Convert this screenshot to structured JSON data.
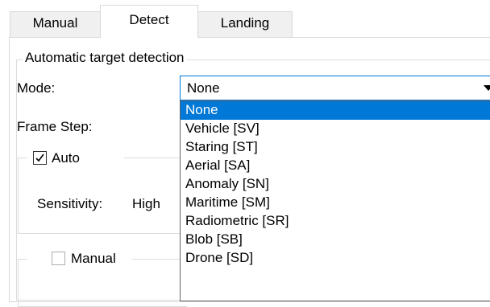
{
  "tabs": [
    {
      "label": "Manual"
    },
    {
      "label": "Detect"
    },
    {
      "label": "Landing"
    }
  ],
  "detection": {
    "group_title": "Automatic target detection",
    "mode_label": "Mode:",
    "frame_step_label": "Frame Step:",
    "mode_value": "None",
    "auto_group": {
      "label": "Auto",
      "checked": true
    },
    "sensitivity_label": "Sensitivity:",
    "sensitivity_value": "High",
    "manual_group": {
      "label": "Manual",
      "checked": false
    }
  },
  "mode_options": [
    "None",
    "Vehicle [SV]",
    "Staring [ST]",
    "Aerial [SA]",
    "Anomaly [SN]",
    "Maritime [SM]",
    "Radiometric [SR]",
    "Blob [SB]",
    "Drone [SD]"
  ],
  "selected_option_index": 0,
  "colors": {
    "accent": "#0078d7",
    "tab_inactive": "#f0f0f0",
    "border": "#d9d9d9"
  },
  "icons": {
    "dropdown_arrow": "triangle-down-icon",
    "checkmark": "checkmark-icon"
  }
}
